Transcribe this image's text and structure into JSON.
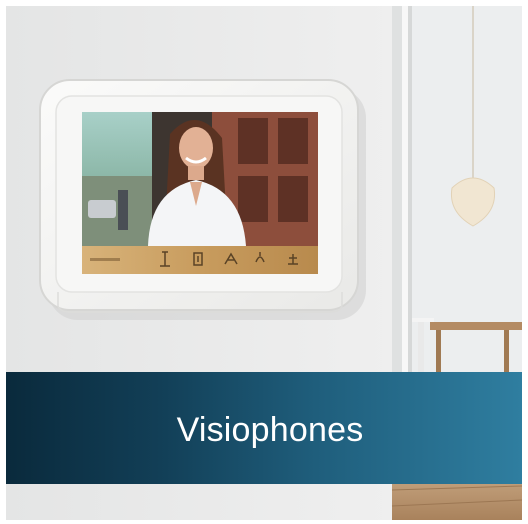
{
  "banner": {
    "title": "Visiophones"
  },
  "colors": {
    "wall": "#e9eaea",
    "room": "#eef0f1",
    "device_body": "#f4f4f2",
    "keypad_strip": "#c49a5c",
    "banner_dark": "#0a2a3c",
    "banner_light": "#2f7ea0",
    "text": "#ffffff"
  },
  "icons": [
    "intercom-monitor-icon",
    "unlock-key-icon",
    "call-key-icon",
    "menu-key-icon",
    "home-key-icon"
  ]
}
